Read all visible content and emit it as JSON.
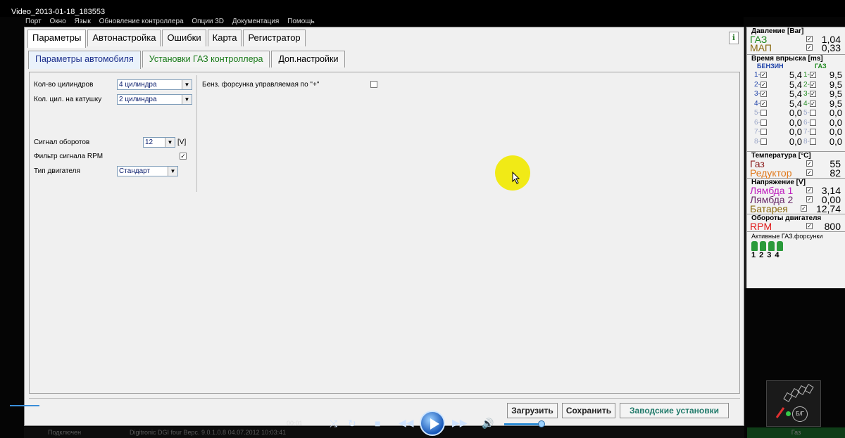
{
  "window": {
    "title": "Video_2013-01-18_183553"
  },
  "menu": [
    "Порт",
    "Окно",
    "Язык",
    "Обновление контроллера",
    "Опции 3D",
    "Документация",
    "Помощь"
  ],
  "main_tabs": [
    "Параметры",
    "Автонастройка",
    "Ошибки",
    "Карта",
    "Регистратор"
  ],
  "sub_tabs": [
    "Параметры автомобиля",
    "Установки ГАЗ контроллера",
    "Доп.настройки"
  ],
  "params": {
    "cyl_count_label": "Кол-во цилиндров",
    "cyl_count_value": "4 цилиндра",
    "cyl_coil_label": "Кол. цил. на катушку",
    "cyl_coil_value": "2 цилиндра",
    "rpm_signal_label": "Сигнал оборотов",
    "rpm_signal_value": "12",
    "rpm_signal_unit": "[V]",
    "rpm_filter_label": "Фильтр сигнала RPM",
    "engine_type_label": "Тип двигателя",
    "engine_type_value": "Стандарт",
    "petrol_injector_label": "Бенз. форсунка управляемая по \"+\""
  },
  "buttons": {
    "load": "Загрузить",
    "save": "Сохранить",
    "factory": "Заводские установки"
  },
  "monitor": {
    "pressure_header": "Давление [Bar]",
    "gas_name": "ГАЗ",
    "gas_value": "1,04",
    "map_name": "МАП",
    "map_value": "0,33",
    "injection_header": "Время впрыска [ms]",
    "petrol_label": "БЕНЗИН",
    "gas_label": "ГАЗ",
    "petrol_values": [
      "5,4",
      "5,4",
      "5,4",
      "5,4",
      "0,0",
      "0,0",
      "0,0",
      "0,0"
    ],
    "gas_values": [
      "9,5",
      "9,5",
      "9,5",
      "9,5",
      "0,0",
      "0,0",
      "0,0",
      "0,0"
    ],
    "temp_header": "Температура [°C]",
    "temp_gas_name": "Газ",
    "temp_gas_value": "55",
    "temp_reducer_name": "Редуктор",
    "temp_reducer_value": "82",
    "voltage_header": "Напряжение [V]",
    "lambda1_name": "Лямбда 1",
    "lambda1_value": "3,14",
    "lambda2_name": "Лямбда 2",
    "lambda2_value": "0,00",
    "battery_name": "Батарея",
    "battery_value": "12,74",
    "rpm_header": "Обороты двигателя",
    "rpm_name": "RPM",
    "rpm_value": "800",
    "active_inj_header": "Активные ГАЗ.форсунки",
    "active_inj_numbers": [
      "1",
      "2",
      "3",
      "4"
    ]
  },
  "status": {
    "connected": "Подключен",
    "version": "Digitronic DGI four  Верс. 9.0.1.0.8    04.07.2012 10:03:41",
    "gas": "Газ"
  },
  "player": {
    "time": "00:01"
  },
  "bg_widget": {
    "label": "Б/Г"
  }
}
